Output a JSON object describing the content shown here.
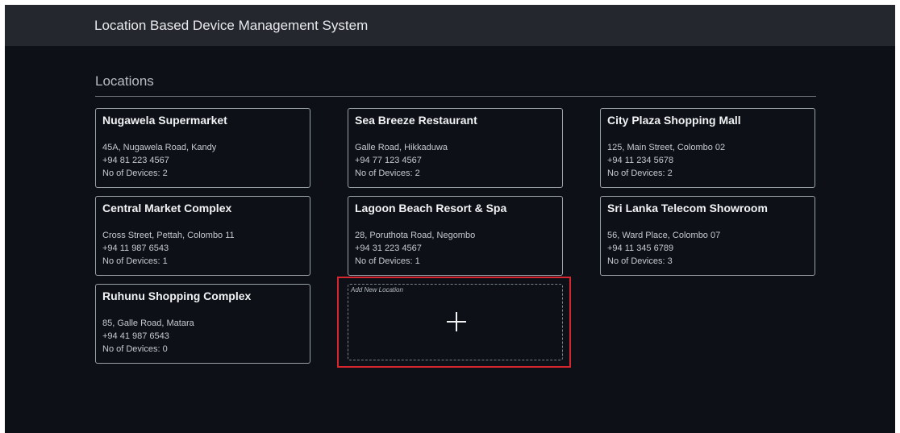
{
  "app": {
    "title": "Location Based Device Management System"
  },
  "section": {
    "title": "Locations"
  },
  "locations": [
    {
      "name": "Nugawela Supermarket",
      "address": "45A, Nugawela Road, Kandy",
      "phone": "+94 81 223 4567",
      "devices": "No of Devices: 2"
    },
    {
      "name": "Sea Breeze Restaurant",
      "address": "Galle Road, Hikkaduwa",
      "phone": "+94 77 123 4567",
      "devices": "No of Devices: 2"
    },
    {
      "name": "City Plaza Shopping Mall",
      "address": "125, Main Street, Colombo 02",
      "phone": "+94 11 234 5678",
      "devices": "No of Devices: 2"
    },
    {
      "name": "Central Market Complex",
      "address": "Cross Street, Pettah, Colombo 11",
      "phone": "+94 11 987 6543",
      "devices": "No of Devices: 1"
    },
    {
      "name": "Lagoon Beach Resort & Spa",
      "address": "28, Poruthota Road, Negombo",
      "phone": "+94 31 223 4567",
      "devices": "No of Devices: 1"
    },
    {
      "name": "Sri Lanka Telecom Showroom",
      "address": "56, Ward Place, Colombo 07",
      "phone": "+94 11 345 6789",
      "devices": "No of Devices: 3"
    },
    {
      "name": "Ruhunu Shopping Complex",
      "address": "85, Galle Road, Matara",
      "phone": "+94 41 987 6543",
      "devices": "No of Devices: 0"
    }
  ],
  "add_location": {
    "label": "Add New Location",
    "icon": "plus-icon",
    "highlight_color": "#d7262e"
  },
  "colors": {
    "background": "#0d1117",
    "appbar": "#24272e"
  }
}
